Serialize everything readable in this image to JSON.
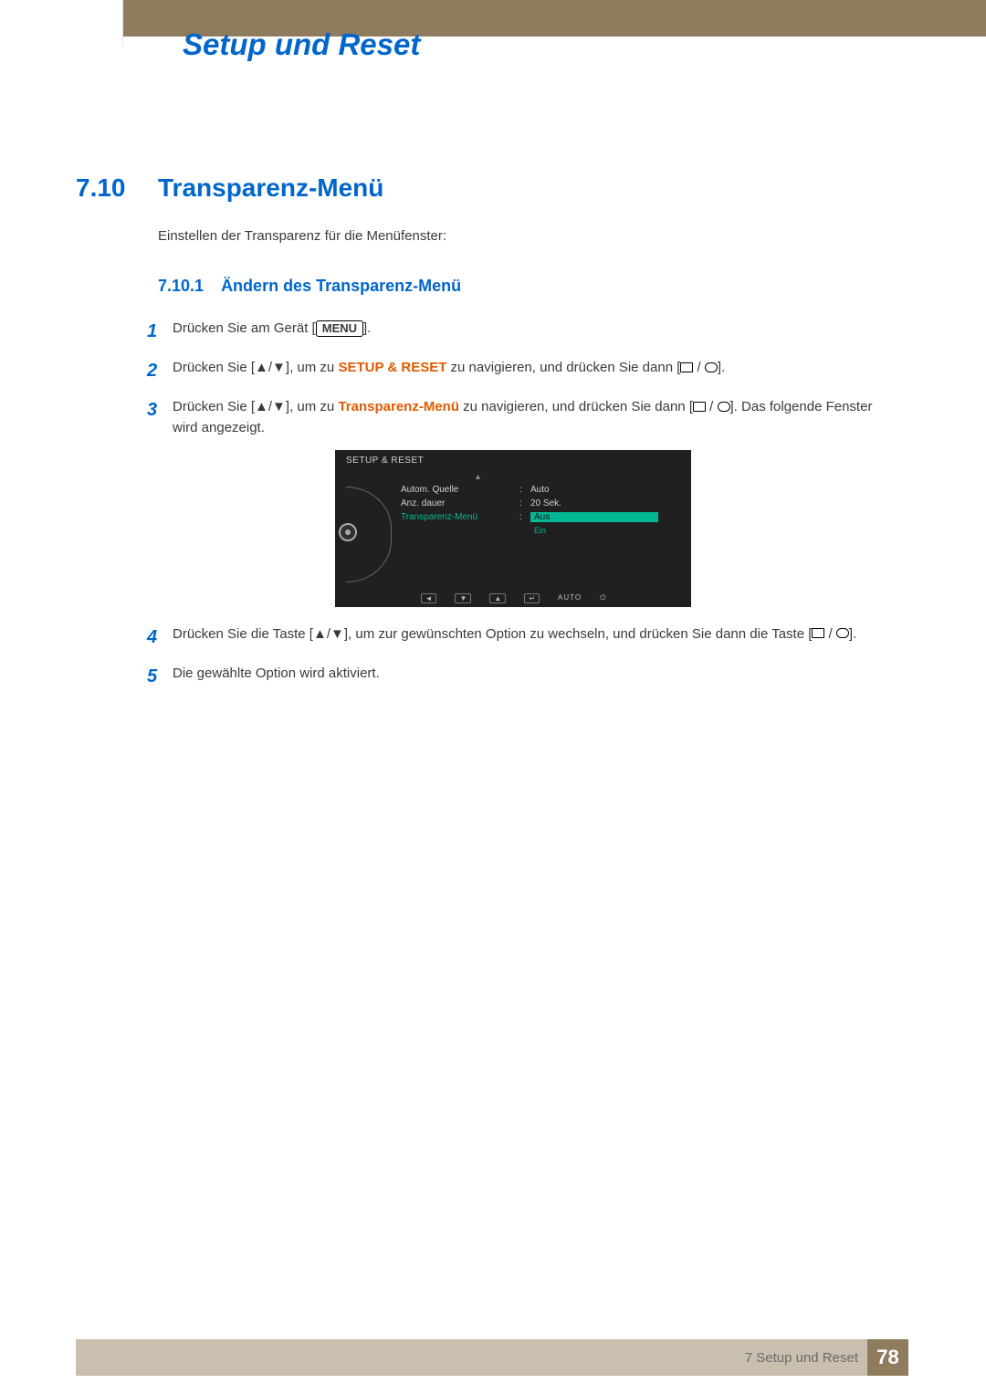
{
  "chapter_title": "Setup und Reset",
  "section": {
    "num": "7.10",
    "title": "Transparenz-Menü"
  },
  "intro": "Einstellen der Transparenz für die Menüfenster:",
  "subsection": {
    "num": "7.10.1",
    "title": "Ändern des Transparenz-Menü"
  },
  "steps": {
    "s1": {
      "num": "1",
      "pre": "Drücken Sie am Gerät [",
      "btn": "MENU",
      "post": "]."
    },
    "s2": {
      "num": "2",
      "a": "Drücken Sie [",
      "arrows": "▲/▼",
      "b": "], um zu ",
      "kw": "SETUP & RESET",
      "c": " zu navigieren, und drücken Sie dann [",
      "d": "]."
    },
    "s3": {
      "num": "3",
      "a": "Drücken Sie [",
      "arrows": "▲/▼",
      "b": "], um zu ",
      "kw": "Transparenz-Menü",
      "c": " zu navigieren, und drücken Sie dann [",
      "d": "]. Das folgende Fenster wird angezeigt."
    },
    "s4": {
      "num": "4",
      "a": "Drücken Sie die Taste [",
      "arrows": "▲/▼",
      "b": "], um zur gewünschten Option zu wechseln, und drücken Sie dann die Taste [",
      "c": "]."
    },
    "s5": {
      "num": "5",
      "text": "Die gewählte Option wird aktiviert."
    }
  },
  "osd": {
    "title": "SETUP & RESET",
    "up": "▲",
    "rows": [
      {
        "label": "Autom. Quelle",
        "value": "Auto"
      },
      {
        "label": "Anz. dauer",
        "value": "20 Sek."
      }
    ],
    "hl": {
      "label": "Transparenz-Menü",
      "value": "Aus",
      "alt": "Ein"
    },
    "footer": {
      "left": "◄",
      "down": "▼",
      "up": "▲",
      "enter": "↵",
      "auto": "AUTO",
      "power": "⏻"
    }
  },
  "footer": {
    "text": "7 Setup und Reset",
    "page": "78"
  }
}
